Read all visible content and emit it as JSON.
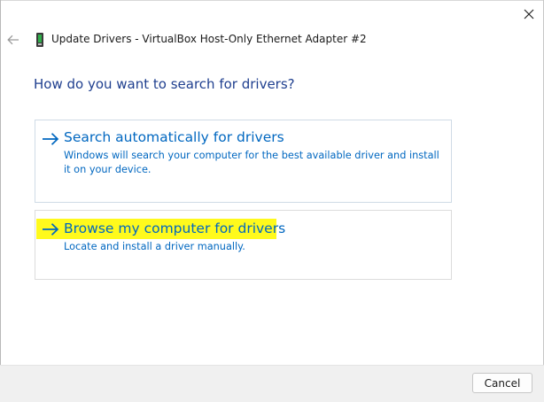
{
  "window": {
    "title": "Update Drivers - VirtualBox Host-Only Ethernet Adapter #2",
    "close_icon": "close-icon",
    "back_icon": "back-arrow-icon",
    "app_icon": "device-driver-icon"
  },
  "main": {
    "heading": "How do you want to search for drivers?",
    "options": [
      {
        "title": "Search automatically for drivers",
        "description": "Windows will search your computer for the best available driver and install it on your device.",
        "icon": "arrow-right-icon"
      },
      {
        "title": "Browse my computer for drivers",
        "description": "Locate and install a driver manually.",
        "icon": "arrow-right-icon",
        "highlighted": true
      }
    ]
  },
  "footer": {
    "cancel_label": "Cancel"
  },
  "colors": {
    "link_blue": "#0067c0",
    "heading_blue": "#1f3f8f",
    "highlight_yellow": "#fffa1c",
    "footer_bg": "#f0f0f0"
  }
}
